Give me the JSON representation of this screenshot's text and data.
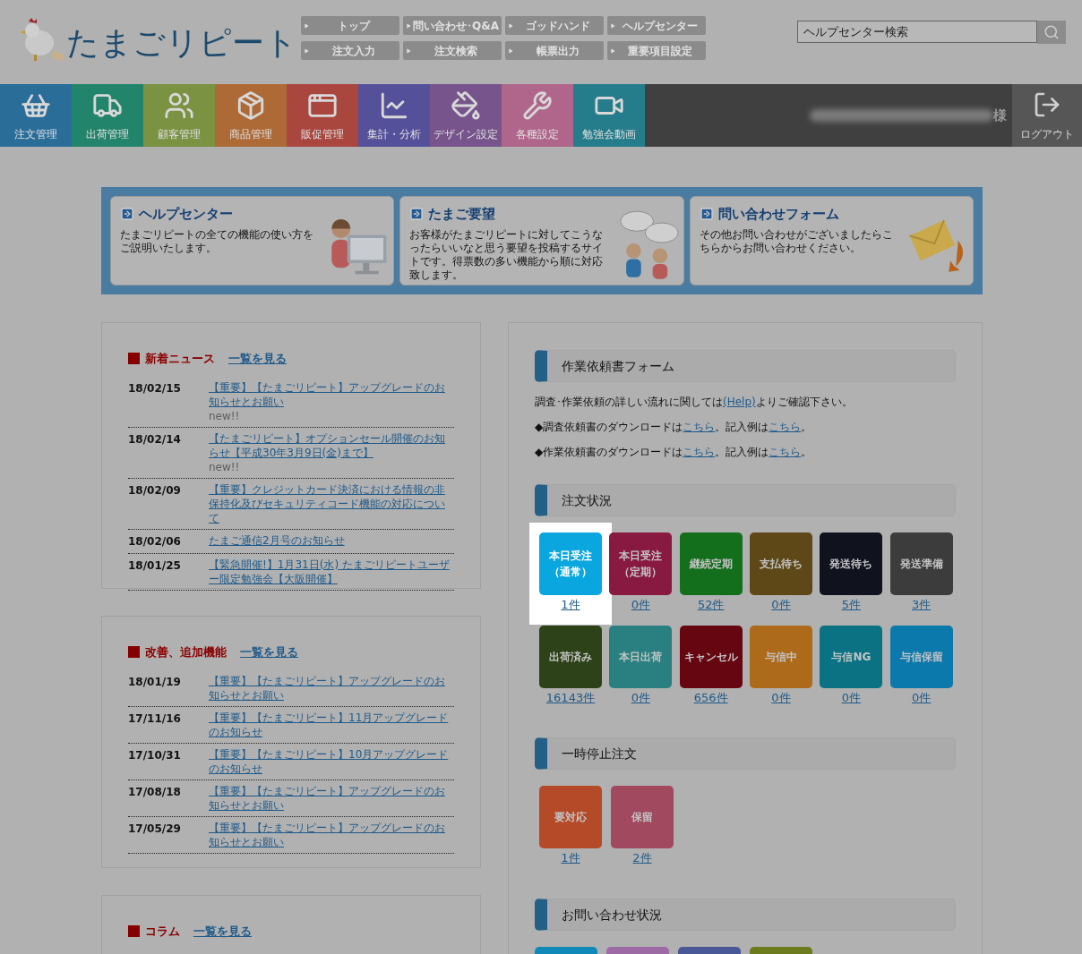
{
  "header": {
    "logo": "たまごリピート",
    "top_links": [
      "トップ",
      "問い合わせ･Q&A",
      "ゴッドハンド",
      "ヘルプセンター",
      "注文入力",
      "注文検索",
      "帳票出力",
      "重要項目設定"
    ],
    "search": {
      "placeholder": "ヘルプセンター検索"
    }
  },
  "nav": {
    "items": [
      {
        "label": "注文管理",
        "color": "#2a6d99"
      },
      {
        "label": "出荷管理",
        "color": "#22846a"
      },
      {
        "label": "顧客管理",
        "color": "#7a9242"
      },
      {
        "label": "商品管理",
        "color": "#ad6a37"
      },
      {
        "label": "販促管理",
        "color": "#a9473f"
      },
      {
        "label": "集計・分析",
        "color": "#55509a"
      },
      {
        "label": "デザイン設定",
        "color": "#77558c"
      },
      {
        "label": "各種設定",
        "color": "#b0668a"
      },
      {
        "label": "勉強会動画",
        "color": "#257c8a"
      }
    ],
    "user_suffix": "様",
    "logout": "ログアウト"
  },
  "help_cards": [
    {
      "title": "ヘルプセンター",
      "text": "たまごリピートの全ての機能の使い方をご説明いたします。"
    },
    {
      "title": "たまご要望",
      "text": "お客様がたまごリピートに対してこうなったらいいなと思う要望を投稿するサイトです。得票数の多い機能から順に対応致します。"
    },
    {
      "title": "問い合わせフォーム",
      "text": "その他お問い合わせがございましたらこちらからお問い合わせください。"
    }
  ],
  "news_sections": [
    {
      "title": "新着ニュース",
      "more": "一覧を見る",
      "items": [
        {
          "date": "18/02/15",
          "title": "【重要】【たまごリピート】アップグレードのお知らせとお願い",
          "badge": "new!!"
        },
        {
          "date": "18/02/14",
          "title": "【たまごリピート】オプションセール開催のお知らせ【平成30年3月9日(金)まで】",
          "badge": "new!!"
        },
        {
          "date": "18/02/09",
          "title": "【重要】クレジットカード決済における情報の非保持化及びセキュリティコード機能の対応について"
        },
        {
          "date": "18/02/06",
          "title": "たまご通信2月号のお知らせ"
        },
        {
          "date": "18/01/25",
          "title": "【緊急開催!】1月31日(水) たまごリピートユーザー限定勉強会【大阪開催】"
        }
      ]
    },
    {
      "title": "改善、追加機能",
      "more": "一覧を見る",
      "items": [
        {
          "date": "18/01/19",
          "title": "【重要】【たまごリピート】アップグレードのお知らせとお願い"
        },
        {
          "date": "17/11/16",
          "title": "【重要】【たまごリピート】11月アップグレードのお知らせ"
        },
        {
          "date": "17/10/31",
          "title": "【重要】【たまごリピート】10月アップグレードのお知らせ"
        },
        {
          "date": "17/08/18",
          "title": "【重要】【たまごリピート】アップグレードのお知らせとお願い"
        },
        {
          "date": "17/05/29",
          "title": "【重要】【たまごリピート】アップグレードのお知らせとお願い"
        }
      ]
    },
    {
      "title": "コラム",
      "more": "一覧を見る"
    }
  ],
  "work_form": {
    "title": "作業依頼書フォーム",
    "lines": [
      [
        {
          "text": "調査･作業依頼の詳しい流れに関しては",
          "link": false
        },
        {
          "text": "(Help)",
          "link": true
        },
        {
          "text": "よりご確認下さい。",
          "link": false
        }
      ],
      [
        {
          "text": "◆調査依頼書のダウンロードは",
          "link": false
        },
        {
          "text": "こちら",
          "link": true
        },
        {
          "text": "。記入例は",
          "link": false
        },
        {
          "text": "こちら",
          "link": true
        },
        {
          "text": "。",
          "link": false
        }
      ],
      [
        {
          "text": "◆作業依頼書のダウンロードは",
          "link": false
        },
        {
          "text": "こちら",
          "link": true
        },
        {
          "text": "。記入例は",
          "link": false
        },
        {
          "text": "こちら",
          "link": true
        },
        {
          "text": "。",
          "link": false
        }
      ]
    ]
  },
  "order_status": {
    "title": "注文状況",
    "tiles": [
      {
        "label": [
          "本日受注",
          "（通常）"
        ],
        "count": "1件",
        "color": "#0aa6e0",
        "highlighted": true
      },
      {
        "label": [
          "本日受注",
          "（定期）"
        ],
        "count": "0件",
        "color": "#881a42",
        "highlighted": false
      },
      {
        "label": [
          "継続定期"
        ],
        "count": "52件",
        "color": "#146f1d",
        "highlighted": false
      },
      {
        "label": [
          "支払待ち"
        ],
        "count": "0件",
        "color": "#5e4818",
        "highlighted": false
      },
      {
        "label": [
          "発送待ち"
        ],
        "count": "5件",
        "color": "#10131e",
        "highlighted": false
      },
      {
        "label": [
          "発送準備"
        ],
        "count": "3件",
        "color": "#3c3c3c",
        "highlighted": false
      },
      {
        "label": [
          "出荷済み"
        ],
        "count": "16143件",
        "color": "#2d4219",
        "highlighted": false
      },
      {
        "label": [
          "本日出荷"
        ],
        "count": "0件",
        "color": "#2a8080",
        "highlighted": false
      },
      {
        "label": [
          "キャンセル"
        ],
        "count": "656件",
        "color": "#650611",
        "highlighted": false
      },
      {
        "label": [
          "与信中"
        ],
        "count": "0件",
        "color": "#ad6a1a",
        "highlighted": false
      },
      {
        "label": [
          "与信NG"
        ],
        "count": "0件",
        "color": "#0a7283",
        "highlighted": false
      },
      {
        "label": [
          "与信保留"
        ],
        "count": "0件",
        "color": "#0c79ad",
        "highlighted": false
      }
    ]
  },
  "paused_orders": {
    "title": "一時停止注文",
    "tiles": [
      {
        "label": [
          "要対応"
        ],
        "count": "1件",
        "color": "#b44a28",
        "highlighted": false
      },
      {
        "label": [
          "保留"
        ],
        "count": "2件",
        "color": "#a1495f",
        "highlighted": false
      }
    ]
  },
  "inquiry_status": {
    "title": "お問い合わせ状況",
    "tiles": [
      {
        "color": "#1089b8"
      },
      {
        "color": "#9d6aa6"
      },
      {
        "color": "#4a5898"
      },
      {
        "color": "#6c7b1d"
      }
    ]
  }
}
